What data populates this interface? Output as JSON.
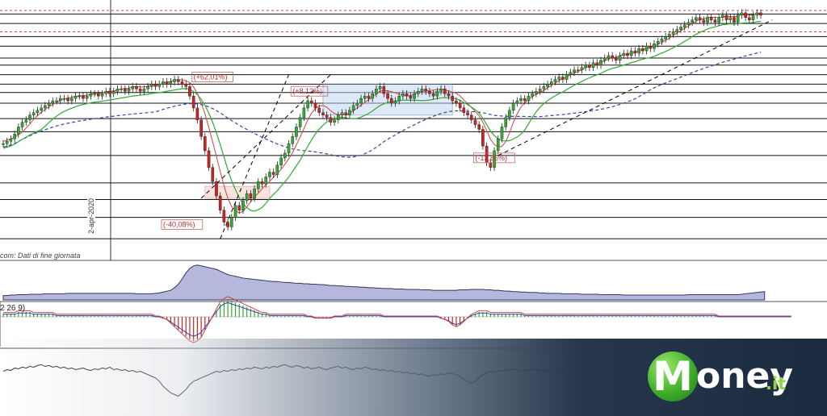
{
  "chart_data": {
    "type": "candlestick",
    "xlim": [
      0,
      200
    ],
    "ylim": [
      0,
      100
    ],
    "x_tick_labels": [
      "2-apr-2020"
    ],
    "source_note": "com: Dati di fine giornata",
    "annotations": [
      {
        "text": "(+62,01%)",
        "x": 50,
        "y": 70
      },
      {
        "text": "(+8,12%)",
        "x": 76,
        "y": 64
      },
      {
        "text": "(-13,86%)",
        "x": 124,
        "y": 36
      },
      {
        "text": "(-40,08%)",
        "x": 42,
        "y": 8
      }
    ],
    "close": [
      43,
      44,
      45,
      47,
      50,
      52,
      53,
      55,
      56,
      57,
      58,
      59,
      60,
      61,
      61,
      62,
      62,
      61,
      62,
      63,
      63,
      62,
      63,
      64,
      64,
      63,
      64,
      65,
      64,
      65,
      66,
      66,
      65,
      66,
      67,
      66,
      65,
      66,
      67,
      68,
      67,
      68,
      69,
      68,
      69,
      70,
      69,
      68,
      67,
      63,
      58,
      53,
      46,
      40,
      33,
      27,
      21,
      15,
      10,
      8,
      12,
      17,
      15,
      19,
      22,
      20,
      24,
      27,
      26,
      29,
      31,
      30,
      34,
      37,
      39,
      43,
      46,
      50,
      54,
      58,
      61,
      60,
      58,
      56,
      55,
      54,
      52,
      53,
      55,
      56,
      55,
      57,
      59,
      60,
      62,
      63,
      62,
      64,
      66,
      67,
      64,
      62,
      60,
      61,
      63,
      64,
      63,
      62,
      64,
      65,
      66,
      65,
      64,
      63,
      65,
      66,
      64,
      63,
      61,
      60,
      58,
      56,
      55,
      53,
      51,
      49,
      42,
      35,
      33,
      40,
      45,
      50,
      54,
      57,
      60,
      61,
      62,
      61,
      63,
      64,
      65,
      66,
      67,
      68,
      69,
      70,
      71,
      70,
      72,
      73,
      74,
      74,
      75,
      76,
      75,
      77,
      76,
      78,
      79,
      80,
      79,
      78,
      80,
      81,
      80,
      82,
      81,
      83,
      82,
      84,
      83,
      85,
      86,
      87,
      88,
      89,
      90,
      91,
      92,
      93,
      94,
      95,
      96,
      95,
      94,
      96,
      95,
      94,
      96,
      97,
      95,
      96,
      94,
      97,
      98,
      96,
      95,
      97,
      98,
      97
    ],
    "horizontal_levels": [
      97.5,
      93.5,
      88,
      84,
      79,
      76,
      72,
      68,
      64.5,
      60,
      53.5,
      48,
      38,
      26.5,
      19.5,
      12,
      3
    ],
    "dashed_levels": [
      99,
      90
    ],
    "upper_panel": [
      10,
      10,
      11,
      11,
      12,
      12,
      12,
      13,
      13,
      13,
      13,
      14,
      14,
      14,
      14,
      14,
      14,
      15,
      15,
      15,
      15,
      15,
      15,
      15,
      15,
      15,
      15,
      15,
      15,
      15,
      15,
      15,
      15,
      15,
      15,
      14,
      14,
      14,
      14,
      14,
      15,
      16,
      18,
      20,
      22,
      28,
      36,
      48,
      62,
      72,
      78,
      80,
      78,
      76,
      74,
      72,
      70,
      66,
      62,
      58,
      56,
      54,
      52,
      50,
      49,
      48,
      47,
      46,
      45,
      44,
      43,
      42,
      42,
      41,
      40,
      40,
      39,
      38,
      38,
      37,
      37,
      36,
      36,
      35,
      35,
      34,
      33,
      33,
      32,
      32,
      31,
      31,
      30,
      30,
      29,
      29,
      28,
      28,
      27,
      27,
      26,
      26,
      26,
      25,
      25,
      25,
      24,
      24,
      24,
      24,
      23,
      23,
      23,
      22,
      22,
      22,
      22,
      22,
      22,
      22,
      23,
      23,
      23,
      24,
      24,
      24,
      24,
      23,
      23,
      22,
      22,
      21,
      20,
      20,
      19,
      19,
      18,
      18,
      17,
      17,
      17,
      16,
      16,
      15,
      15,
      15,
      15,
      14,
      14,
      14,
      14,
      14,
      13,
      13,
      13,
      13,
      13,
      12,
      12,
      12,
      12,
      12,
      12,
      11,
      11,
      11,
      11,
      11,
      11,
      11,
      11,
      11,
      11,
      11,
      11,
      11,
      11,
      11,
      11,
      11,
      12,
      12,
      12,
      12,
      12,
      12,
      12,
      12,
      12,
      12,
      12,
      12,
      12,
      12,
      13,
      14,
      15,
      16,
      17,
      18,
      19
    ],
    "macd_label": "2 26 9)",
    "macd_hist": [
      2,
      2,
      2,
      2,
      3,
      3,
      3,
      3,
      2,
      2,
      2,
      2,
      2,
      2,
      1,
      1,
      1,
      1,
      1,
      1,
      1,
      1,
      1,
      1,
      1,
      1,
      1,
      1,
      1,
      1,
      1,
      1,
      1,
      1,
      1,
      1,
      1,
      1,
      1,
      1,
      0,
      0,
      -1,
      -2,
      -4,
      -6,
      -8,
      -10,
      -12,
      -14,
      -15,
      -14,
      -12,
      -8,
      -4,
      0,
      4,
      8,
      10,
      11,
      10,
      9,
      8,
      7,
      6,
      5,
      4,
      3,
      2,
      2,
      1,
      1,
      1,
      1,
      1,
      1,
      1,
      1,
      1,
      1,
      0,
      0,
      -1,
      -1,
      -1,
      -1,
      -1,
      0,
      0,
      0,
      1,
      1,
      1,
      1,
      1,
      1,
      1,
      1,
      1,
      1,
      0,
      0,
      0,
      0,
      0,
      0,
      0,
      0,
      0,
      0,
      0,
      0,
      0,
      0,
      0,
      -1,
      -2,
      -3,
      -5,
      -6,
      -5,
      -3,
      -1,
      1,
      2,
      3,
      3,
      3,
      2,
      2,
      2,
      2,
      2,
      2,
      2,
      2,
      2,
      1,
      1,
      1,
      1,
      1,
      1,
      1,
      1,
      1,
      1,
      1,
      1,
      1,
      1,
      1,
      1,
      1,
      1,
      1,
      1,
      1,
      1,
      1,
      1,
      1,
      1,
      1,
      1,
      1,
      1,
      1,
      1,
      1,
      1,
      1,
      1,
      1,
      1,
      1,
      1,
      1,
      1,
      1,
      1,
      1,
      1,
      1,
      1,
      1,
      1,
      1,
      0,
      0,
      0,
      0,
      0,
      0,
      0,
      0,
      0,
      0,
      0,
      0,
      0,
      0,
      0,
      0,
      0,
      0,
      0,
      0
    ],
    "lower_panel": [
      50,
      52,
      51,
      54,
      53,
      55,
      54,
      56,
      55,
      57,
      58,
      56,
      57,
      55,
      56,
      54,
      55,
      53,
      54,
      52,
      53,
      54,
      52,
      51,
      53,
      52,
      54,
      53,
      55,
      52,
      53,
      51,
      52,
      50,
      51,
      49,
      50,
      48,
      46,
      44,
      42,
      38,
      32,
      28,
      24,
      22,
      20,
      24,
      28,
      34,
      38,
      40,
      42,
      44,
      46,
      48,
      50,
      49,
      51,
      50,
      52,
      51,
      53,
      52,
      54,
      53,
      55,
      54,
      53,
      55,
      54,
      56,
      55,
      57,
      58,
      56,
      55,
      57,
      56,
      54,
      55,
      53,
      54,
      55,
      53,
      52,
      54,
      55,
      56,
      54,
      55,
      53,
      52,
      54,
      53,
      55,
      54,
      52,
      53,
      51,
      52,
      50,
      51,
      49,
      50,
      48,
      49,
      47,
      48,
      46,
      47,
      45,
      44,
      46,
      45,
      47,
      46,
      48,
      47,
      46,
      44,
      40,
      38,
      36,
      38,
      42,
      46,
      48,
      50,
      49,
      51,
      50,
      52,
      51,
      53,
      52,
      50,
      51,
      52,
      53,
      51,
      52,
      50,
      51,
      49,
      50,
      52,
      51,
      53,
      52,
      51,
      50,
      52,
      51,
      50,
      49,
      51,
      50,
      49,
      48,
      50,
      49,
      51,
      50,
      52,
      51,
      53,
      52,
      50,
      51,
      49,
      50,
      48,
      49,
      47,
      48,
      46,
      47,
      48,
      49,
      50,
      52,
      51,
      50,
      52,
      51,
      53,
      52,
      51,
      50,
      49,
      50,
      52,
      53,
      54,
      53,
      52
    ]
  }
}
